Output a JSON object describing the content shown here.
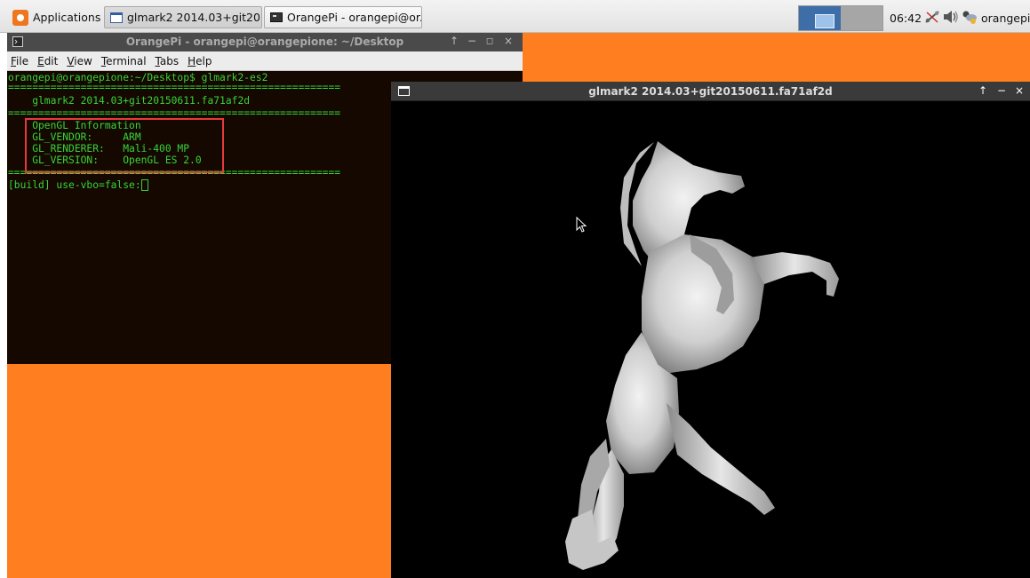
{
  "panel": {
    "applications_label": "Applications",
    "tasks": [
      {
        "label": "glmark2 2014.03+git201...",
        "active": true
      },
      {
        "label": "OrangePi - orangepi@or...",
        "active": false
      }
    ],
    "clock": "06:42",
    "user": "orangepi",
    "icons": [
      "orangepi-logo-icon",
      "window-icon",
      "terminal-icon",
      "network-icon",
      "volume-icon",
      "weather-icon"
    ]
  },
  "terminal": {
    "title": "OrangePi - orangepi@orangepione: ~/Desktop",
    "menu": [
      "File",
      "Edit",
      "View",
      "Terminal",
      "Tabs",
      "Help"
    ],
    "lines": [
      "orangepi@orangepione:~/Desktop$ glmark2-es2",
      "=======================================================",
      "    glmark2 2014.03+git20150611.fa71af2d",
      "=======================================================",
      "    OpenGL Information",
      "    GL_VENDOR:     ARM",
      "    GL_RENDERER:   Mali-400 MP",
      "    GL_VERSION:    OpenGL ES 2.0",
      "======================================================="
    ],
    "prompt_line": "[build] use-vbo=false:",
    "colors": {
      "text": "#39d339",
      "background": "#140800",
      "highlight": "#e53b3b"
    }
  },
  "glmark_window": {
    "title": "glmark2 2014.03+git20150611.fa71af2d",
    "controls": [
      "↑",
      "−",
      "×"
    ]
  },
  "colors": {
    "desktop": "#ff7f20",
    "panel": "#e9e9e9",
    "workspace_active": "#3d6ea8"
  }
}
